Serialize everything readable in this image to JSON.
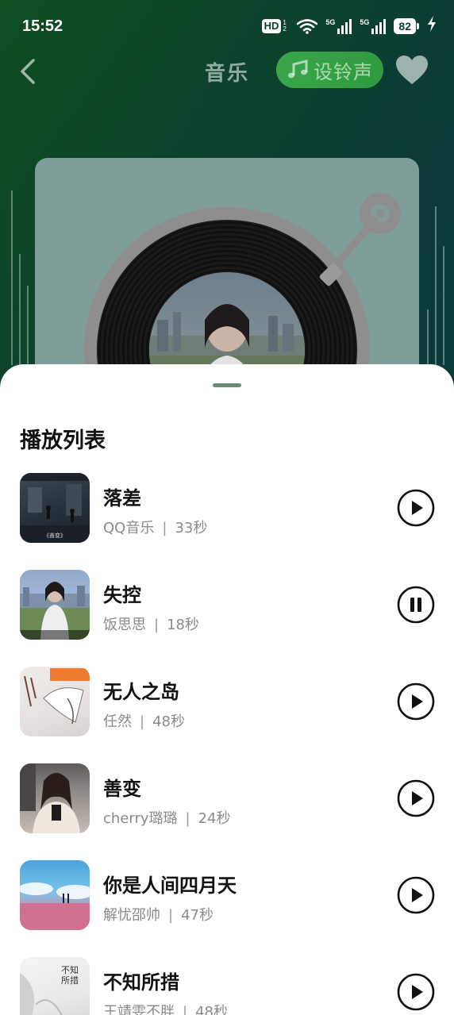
{
  "status_bar": {
    "time": "15:52",
    "hd": "HD",
    "hd_sub": "1 2",
    "signal1_label": "5G",
    "signal2_label": "5G",
    "battery": "82"
  },
  "header": {
    "title": "音乐",
    "ringtone_label": "设铃声"
  },
  "playlist": {
    "title": "播放列表",
    "tracks": [
      {
        "title": "落差",
        "artist": "QQ音乐",
        "separator": "|",
        "duration": "33秒",
        "state": "play",
        "cover_text": "《善变》"
      },
      {
        "title": "失控",
        "artist": "饭思思",
        "separator": "|",
        "duration": "18秒",
        "state": "pause",
        "cover_text": ""
      },
      {
        "title": "无人之岛",
        "artist": "任然",
        "separator": "|",
        "duration": "48秒",
        "state": "play",
        "cover_text": ""
      },
      {
        "title": "善变",
        "artist": "cherry璐璐",
        "separator": "|",
        "duration": "24秒",
        "state": "play",
        "cover_text": ""
      },
      {
        "title": "你是人间四月天",
        "artist": "解忧邵帅",
        "separator": "|",
        "duration": "47秒",
        "state": "play",
        "cover_text": ""
      },
      {
        "title": "不知所措",
        "artist": "王靖雯不胖",
        "separator": "|",
        "duration": "48秒",
        "state": "play",
        "cover_text": "不知所措"
      }
    ]
  },
  "colors": {
    "accent_green": "#3aa64a",
    "handle": "#6b8a74"
  }
}
